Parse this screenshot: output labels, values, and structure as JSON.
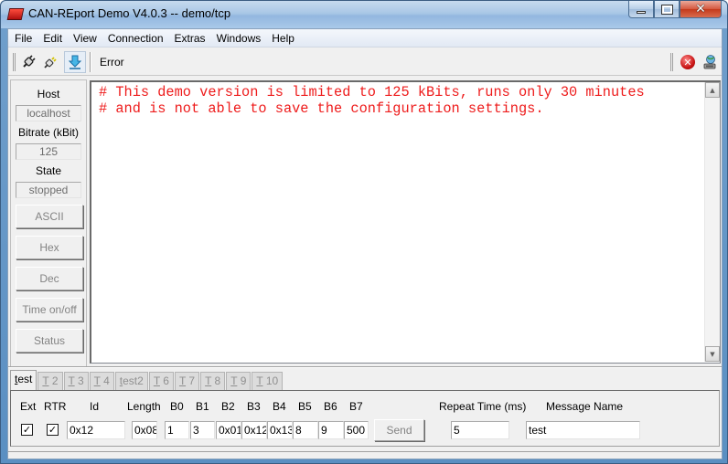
{
  "window": {
    "title": "CAN-REport Demo V4.0.3 -- demo/tcp",
    "controls": {
      "minimize": "minimize",
      "maximize": "maximize",
      "close": "close"
    }
  },
  "menu": {
    "items": [
      "File",
      "Edit",
      "View",
      "Connection",
      "Extras",
      "Windows",
      "Help"
    ]
  },
  "toolbar": {
    "buttons": [
      {
        "name": "connect-icon",
        "glyph": "🔌"
      },
      {
        "name": "disconnect-icon",
        "glyph": "🔌"
      },
      {
        "name": "download-icon",
        "glyph": "⇩"
      }
    ],
    "status_label": "Error",
    "right_buttons": [
      {
        "name": "stop-error-icon",
        "glyph": "✕"
      },
      {
        "name": "network-user-icon",
        "glyph": "👤"
      }
    ]
  },
  "sidebar": {
    "host_label": "Host",
    "host_value": "localhost",
    "bitrate_label": "Bitrate (kBit)",
    "bitrate_value": "125",
    "state_label": "State",
    "state_value": "stopped",
    "buttons": [
      "ASCII",
      "Hex",
      "Dec",
      "Time on/off",
      "Status"
    ]
  },
  "console": {
    "lines": [
      "# This demo version is limited to 125 kBits, runs only 30 minutes",
      "# and is not able to save the configuration settings."
    ],
    "text_color": "#ee1c1c"
  },
  "tabs": [
    {
      "label": "test",
      "active": true
    },
    {
      "label": "T 2",
      "active": false
    },
    {
      "label": "T 3",
      "active": false
    },
    {
      "label": "T 4",
      "active": false
    },
    {
      "label": "test2",
      "active": false
    },
    {
      "label": "T 6",
      "active": false
    },
    {
      "label": "T 7",
      "active": false
    },
    {
      "label": "T 8",
      "active": false
    },
    {
      "label": "T 9",
      "active": false
    },
    {
      "label": "T 10",
      "active": false
    }
  ],
  "send_panel": {
    "labels": {
      "ext": "Ext",
      "rtr": "RTR",
      "id": "Id",
      "length": "Length",
      "b0": "B0",
      "b1": "B1",
      "b2": "B2",
      "b3": "B3",
      "b4": "B4",
      "b5": "B5",
      "b6": "B6",
      "b7": "B7",
      "repeat": "Repeat Time (ms)",
      "msg_name": "Message Name"
    },
    "ext_checked": true,
    "rtr_checked": true,
    "id": "0x12",
    "length": "0x08",
    "bytes": [
      "1",
      "3",
      "0x01",
      "0x12",
      "0x13",
      "8",
      "9",
      "500"
    ],
    "send_label": "Send",
    "repeat_time": "5",
    "message_name": "test"
  }
}
